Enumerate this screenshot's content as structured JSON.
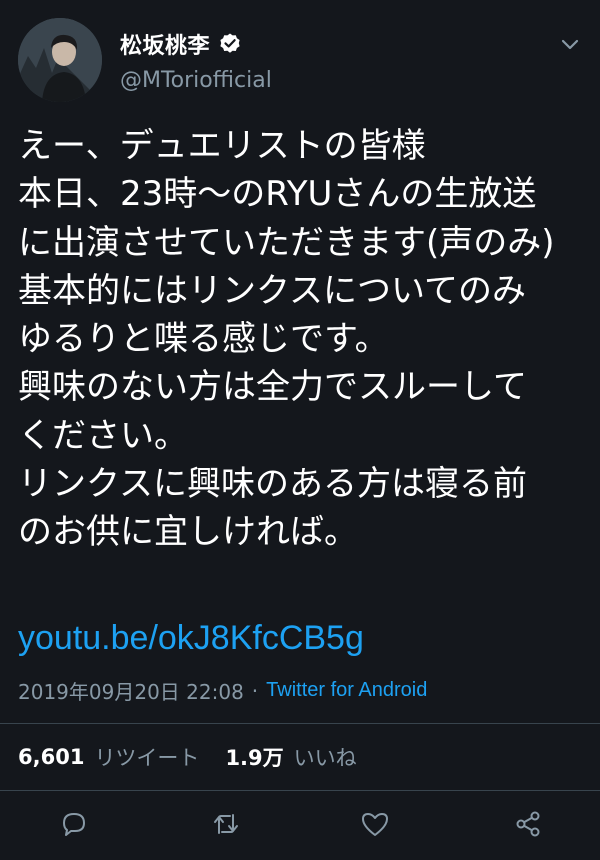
{
  "author": {
    "display_name": "松坂桃李",
    "handle": "@MToriofficial",
    "verified": true,
    "avatar_icon": "profile-photo"
  },
  "tweet": {
    "text": "えー、デュエリストの皆様\n本日、23時〜のRYUさんの生放送\nに出演させていただきます(声のみ)\n基本的にはリンクスについてのみ\nゆるりと喋る感じです。\n興味のない方は全力でスルーして\nください。\nリンクスに興味のある方は寝る前\nのお供に宜しければ。",
    "link": "youtu.be/okJ8KfcCB5g",
    "timestamp": "2019年09月20日 22:08",
    "separator": "·",
    "source": "Twitter for Android"
  },
  "stats": {
    "retweets_count": "6,601",
    "retweets_label": "リツイート",
    "likes_count": "1.9万",
    "likes_label": "いいね"
  },
  "icons": {
    "reply": "reply-icon",
    "retweet": "retweet-icon",
    "like": "heart-icon",
    "share": "share-icon",
    "menu": "chevron-down-icon",
    "verified": "verified-badge-icon"
  },
  "colors": {
    "background": "#14171c",
    "text": "#ffffff",
    "muted": "#8899a6",
    "link": "#1da1f2",
    "divider": "#38444d"
  }
}
